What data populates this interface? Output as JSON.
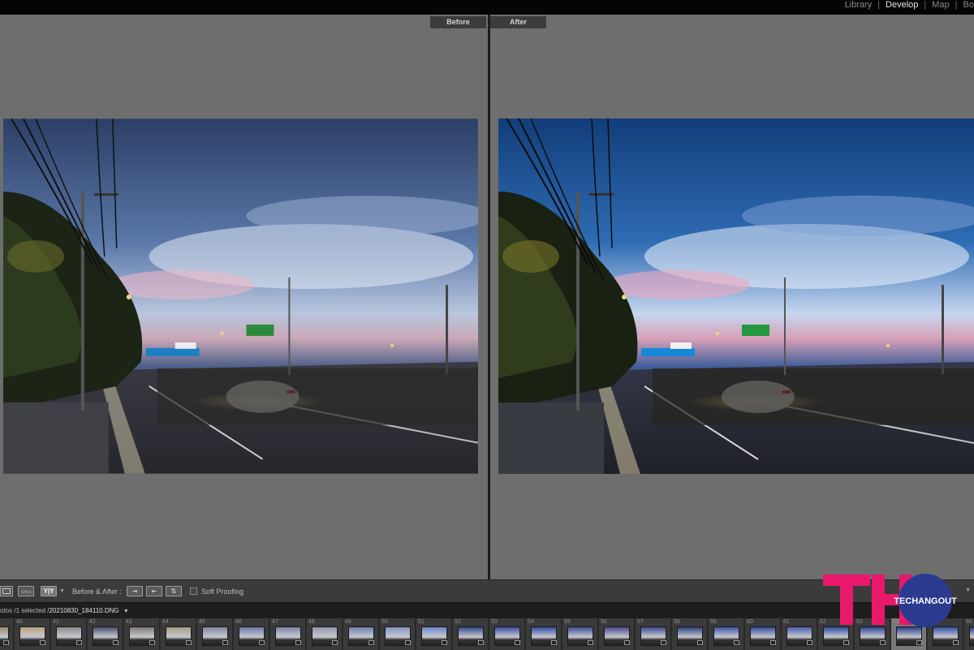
{
  "topbar": {
    "modules": [
      "Library",
      "Develop",
      "Map",
      "Bo"
    ],
    "active_module": "Develop"
  },
  "panes": {
    "before_label": "Before",
    "after_label": "After"
  },
  "toolbar": {
    "view_yy_label": "Y|Y",
    "before_after_label": "Before & After :",
    "soft_proofing_label": "Soft Proofing",
    "soft_proofing_checked": false
  },
  "filmstrip_header": {
    "counts_text": "otos /1 selected /",
    "filename": "20210830_184110.DNG",
    "dropdown_icon": "chevron-down-icon"
  },
  "filmstrip": {
    "numbers": [
      "",
      "40",
      "41",
      "42",
      "43",
      "44",
      "45",
      "46",
      "47",
      "48",
      "49",
      "50",
      "51",
      "52",
      "53",
      "54",
      "55",
      "56",
      "57",
      "58",
      "59",
      "60",
      "61",
      "62",
      "63",
      "64",
      "65",
      "66"
    ],
    "selected_index": 25
  },
  "logo": {
    "mark": "TH",
    "text": "TECHANGOUT"
  },
  "colors": {
    "accent_logo": "#e8186d",
    "logo_circle": "#2b3b8f",
    "pane_gray": "#6e6e6e"
  }
}
